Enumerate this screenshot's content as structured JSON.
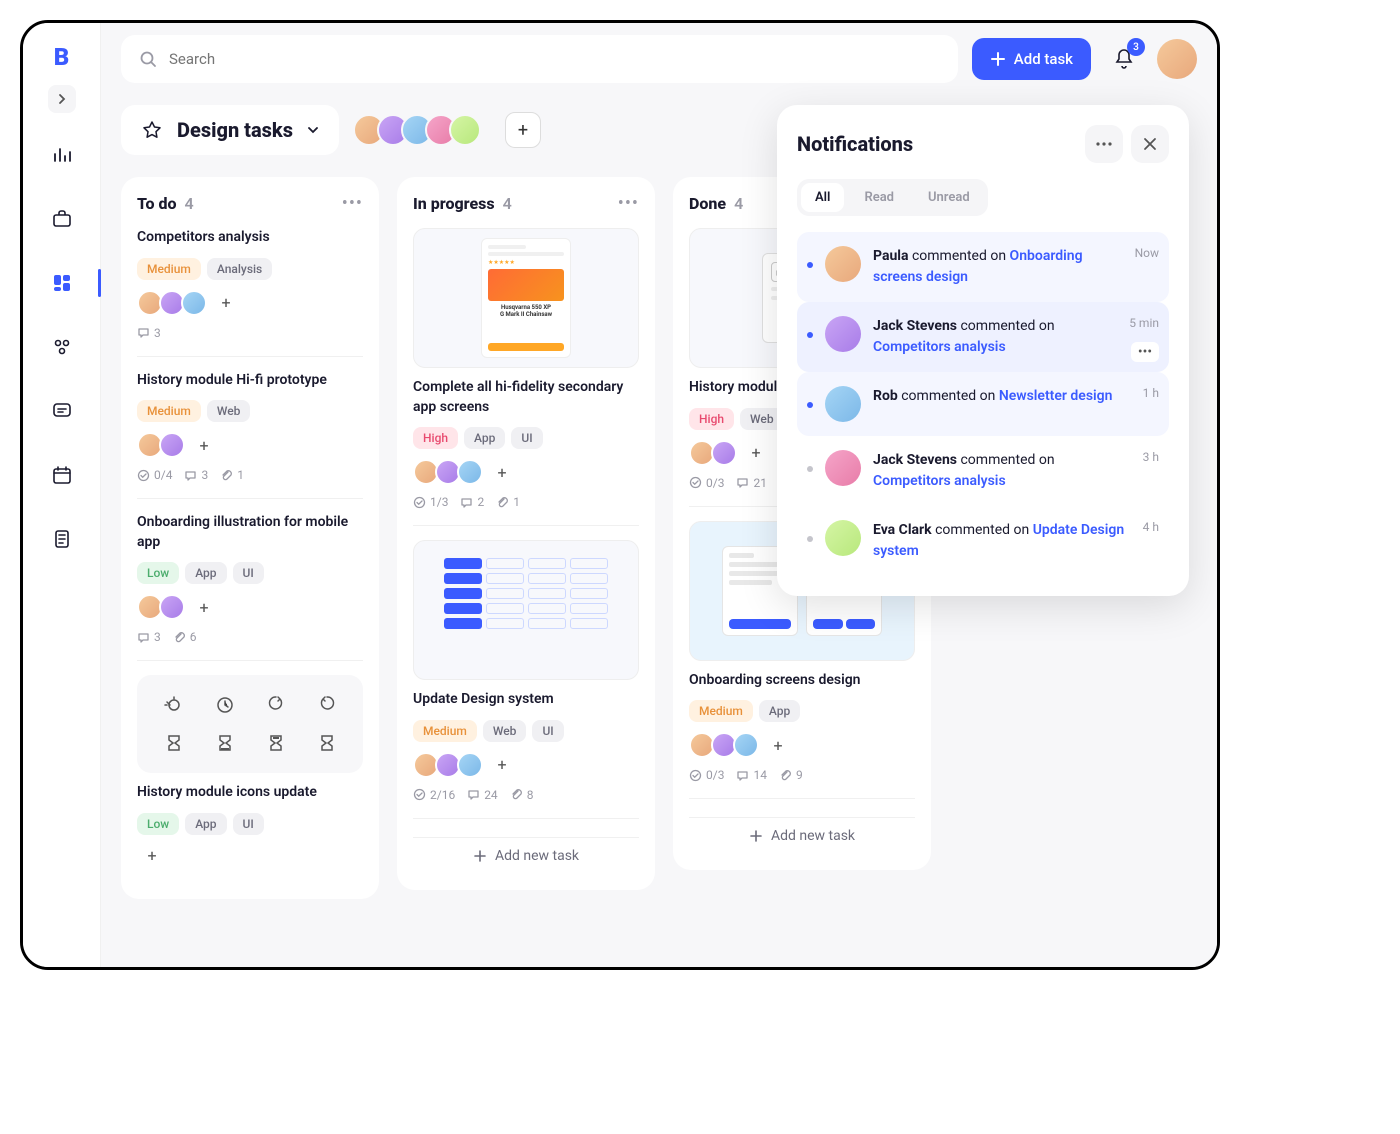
{
  "search": {
    "placeholder": "Search"
  },
  "add_task_label": "Add task",
  "notification_count": "3",
  "board": {
    "title": "Design tasks"
  },
  "columns": [
    {
      "title": "To do",
      "count": "4",
      "cards": [
        {
          "title": "Competitors analysis",
          "priority": "Medium",
          "priority_class": "tag-medium",
          "tags": [
            "Analysis"
          ],
          "avatars": 3,
          "subtasks": "",
          "comments": "3",
          "attachments": ""
        },
        {
          "title": "History module Hi-fi prototype",
          "priority": "Medium",
          "priority_class": "tag-medium",
          "tags": [
            "Web"
          ],
          "avatars": 2,
          "subtasks": "0/4",
          "comments": "3",
          "attachments": "1"
        },
        {
          "title": "Onboarding illustration for mobile app",
          "priority": "Low",
          "priority_class": "tag-low",
          "tags": [
            "App",
            "UI"
          ],
          "avatars": 2,
          "subtasks": "",
          "comments": "3",
          "attachments": "6"
        },
        {
          "title": "History module icons update",
          "priority": "Low",
          "priority_class": "tag-low",
          "tags": [
            "App",
            "UI"
          ],
          "avatars": 0,
          "subtasks": "",
          "comments": "",
          "attachments": "",
          "has_icon_grid": true
        }
      ]
    },
    {
      "title": "In progress",
      "count": "4",
      "cards": [
        {
          "title": "Complete all hi-fidelity secondary app screens",
          "priority": "High",
          "priority_class": "tag-high",
          "tags": [
            "App",
            "UI"
          ],
          "avatars": 3,
          "subtasks": "1/3",
          "comments": "2",
          "attachments": "1",
          "thumb": "product"
        },
        {
          "title": "Update Design system",
          "priority": "Medium",
          "priority_class": "tag-medium",
          "tags": [
            "Web",
            "UI"
          ],
          "avatars": 3,
          "subtasks": "2/16",
          "comments": "24",
          "attachments": "8",
          "thumb": "design"
        }
      ],
      "add_new": "Add new task"
    },
    {
      "title": "Done",
      "count": "4",
      "cards": [
        {
          "title": "History module Hi-fi prototype",
          "priority": "High",
          "priority_class": "tag-high",
          "tags": [
            "Web"
          ],
          "avatars": 2,
          "subtasks": "0/3",
          "comments": "21",
          "attachments": "",
          "thumb": "placeholder"
        },
        {
          "title": "Onboarding screens design",
          "priority": "Medium",
          "priority_class": "tag-medium",
          "tags": [
            "App"
          ],
          "avatars": 3,
          "subtasks": "0/3",
          "comments": "14",
          "attachments": "9",
          "thumb": "screens"
        }
      ],
      "add_new": "Add new task"
    }
  ],
  "notifications": {
    "title": "Notifications",
    "tabs": {
      "all": "All",
      "read": "Read",
      "unread": "Unread"
    },
    "items": [
      {
        "author": "Paula",
        "action": "commented on",
        "link": "Onboarding screens design",
        "time": "Now",
        "unread": true
      },
      {
        "author": "Jack Stevens",
        "action": "commented on",
        "link": "Competitors analysis",
        "time": "5 min",
        "unread": true,
        "hover": true
      },
      {
        "author": "Rob",
        "action": "commented on",
        "link": "Newsletter design",
        "time": "1 h",
        "unread": true
      },
      {
        "author": "Jack Stevens",
        "action": "commented on",
        "link": "Competitors analysis",
        "time": "3 h",
        "unread": false
      },
      {
        "author": "Eva Clark",
        "action": "commented on",
        "link": "Update Design system",
        "time": "4 h",
        "unread": false
      }
    ]
  }
}
